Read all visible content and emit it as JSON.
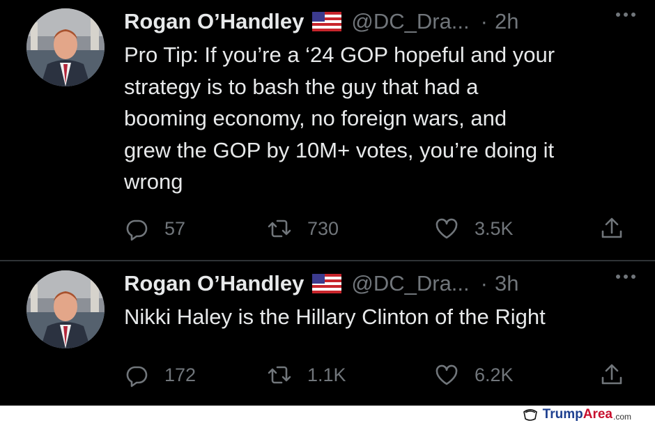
{
  "tweets": [
    {
      "author_name": "Rogan O’Handley",
      "handle": "@DC_Dra...",
      "separator": "·",
      "time": "2h",
      "text": "Pro Tip: If you’re a ‘24 GOP hopeful and your\nstrategy is to bash the guy that had a\nbooming economy, no foreign wars, and\ngrew the GOP by 10M+ votes, you’re doing it\nwrong",
      "replies": "57",
      "retweets": "730",
      "likes": "3.5K"
    },
    {
      "author_name": "Rogan O’Handley",
      "handle": "@DC_Dra...",
      "separator": "·",
      "time": "3h",
      "text": "Nikki Haley is the Hillary Clinton of the Right",
      "replies": "172",
      "retweets": "1.1K",
      "likes": "6.2K"
    }
  ],
  "icons": {
    "flag": "us-flag-icon",
    "more": "more-icon",
    "reply": "reply-icon",
    "retweet": "retweet-icon",
    "like": "heart-icon",
    "share": "share-icon"
  },
  "watermark": {
    "part1": "Trump",
    "part2": "Area",
    "part3": ".com"
  },
  "colors": {
    "background": "#000000",
    "text": "#e7e9ea",
    "muted": "#71767b",
    "divider": "#2f3336"
  }
}
